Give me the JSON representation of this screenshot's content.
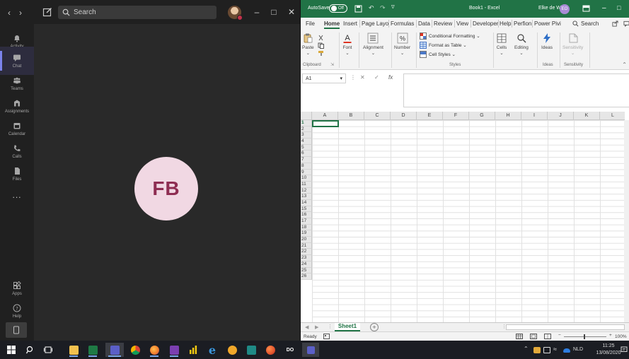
{
  "teams": {
    "search_placeholder": "Search",
    "rail": [
      {
        "label": "Activity",
        "icon": "bell-icon"
      },
      {
        "label": "Chat",
        "icon": "chat-icon"
      },
      {
        "label": "Teams",
        "icon": "teams-icon"
      },
      {
        "label": "Assignments",
        "icon": "assignments-icon"
      },
      {
        "label": "Calendar",
        "icon": "calendar-icon"
      },
      {
        "label": "Calls",
        "icon": "phone-icon"
      },
      {
        "label": "Files",
        "icon": "files-icon"
      },
      {
        "label": "Apps",
        "icon": "apps-icon"
      },
      {
        "label": "Help",
        "icon": "help-icon"
      }
    ],
    "more": "...",
    "call_initials": "FB",
    "colors": {
      "accent": "#7b83eb",
      "avatar_bg": "#f1d8e3",
      "avatar_text": "#8e2d52"
    }
  },
  "excel": {
    "autosave_label": "AutoSave",
    "autosave_state": "Off",
    "doc_title": "Book1  -  Excel",
    "user_name": "Elke de Wit",
    "user_initials": "EO",
    "tabs": [
      "File",
      "Home",
      "Insert",
      "Page Layo",
      "Formulas",
      "Data",
      "Review",
      "View",
      "Developer",
      "Help",
      "Perfion",
      "Power Pivi"
    ],
    "search_label": "Search",
    "ribbon": {
      "paste": "Paste",
      "clipboard": "Clipboard",
      "font": "Font",
      "alignment": "Alignment",
      "number": "Number",
      "conditional_formatting": "Conditional Formatting",
      "format_as_table": "Format as Table",
      "cell_styles": "Cell Styles",
      "styles": "Styles",
      "cells": "Cells",
      "editing": "Editing",
      "ideas_btn": "Ideas",
      "ideas_group": "Ideas",
      "sensitivity_btn": "Sensitivity",
      "sensitivity_group": "Sensitivity"
    },
    "name_box": "A1",
    "fx_label": "fx",
    "columns": [
      "A",
      "B",
      "C",
      "D",
      "E",
      "F",
      "G",
      "H",
      "I",
      "J",
      "K",
      "L"
    ],
    "rows": [
      "1",
      "2",
      "3",
      "4",
      "5",
      "6",
      "7",
      "8",
      "9",
      "10",
      "11",
      "12",
      "13",
      "14",
      "15",
      "16",
      "17",
      "18",
      "19",
      "20",
      "21",
      "22",
      "23",
      "24",
      "25",
      "26"
    ],
    "sheet_name": "Sheet1",
    "status": "Ready",
    "zoom": "100%",
    "colors": {
      "brand": "#217346"
    }
  },
  "taskbar": {
    "apps": [
      {
        "name": "file-explorer-icon",
        "color": "#f2c14e"
      },
      {
        "name": "excel-icon",
        "color": "#1f7a45"
      },
      {
        "name": "teams-icon",
        "color": "#5b5fc7",
        "active": true
      },
      {
        "name": "chrome-icon",
        "color": "#e8b22d"
      },
      {
        "name": "firefox-icon",
        "color": "#f07b2c"
      },
      {
        "name": "onenote-icon",
        "color": "#7b3fb0"
      },
      {
        "name": "power-bi-icon",
        "color": "#f2c811"
      },
      {
        "name": "edge-icon",
        "color": "#3a96dd"
      },
      {
        "name": "cloud-app-icon",
        "color": "#f0a72a"
      },
      {
        "name": "sway-icon",
        "color": "#1f8a86"
      },
      {
        "name": "browser-icon",
        "color": "#e2552d"
      },
      {
        "name": "ink-app-icon",
        "color": "#ffffff",
        "text": "DO"
      },
      {
        "name": "teams-small-icon",
        "color": "#5b5fc7"
      }
    ],
    "language": "NLD",
    "time": "11:25",
    "date": "13/08/2020"
  }
}
